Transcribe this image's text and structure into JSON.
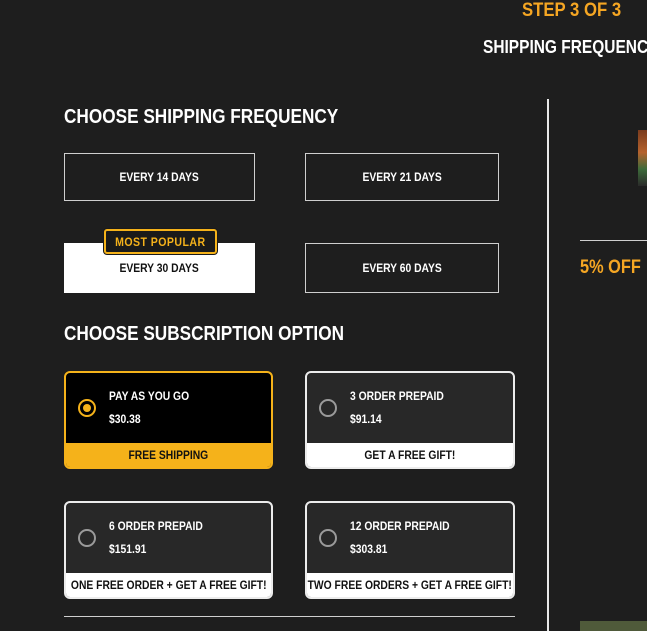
{
  "header": {
    "step": "STEP 3 OF 3",
    "title": "SHIPPING FREQUENCY"
  },
  "frequency": {
    "heading": "CHOOSE SHIPPING FREQUENCY",
    "options": [
      {
        "label": "EVERY 14 DAYS",
        "selected": false
      },
      {
        "label": "EVERY 21 DAYS",
        "selected": false
      },
      {
        "label": "EVERY 30 DAYS",
        "selected": true
      },
      {
        "label": "EVERY 60 DAYS",
        "selected": false
      }
    ],
    "badge": "MOST POPULAR"
  },
  "subscription": {
    "heading": "CHOOSE SUBSCRIPTION OPTION",
    "options": [
      {
        "name": "PAY AS YOU GO",
        "price": "$30.38",
        "perk": "FREE SHIPPING",
        "selected": true
      },
      {
        "name": "3 ORDER PREPAID",
        "price": "$91.14",
        "perk": "GET A FREE GIFT!",
        "selected": false
      },
      {
        "name": "6 ORDER PREPAID",
        "price": "$151.91",
        "perk": "ONE FREE ORDER + GET A FREE GIFT!",
        "selected": false
      },
      {
        "name": "12 ORDER PREPAID",
        "price": "$303.81",
        "perk": "TWO FREE ORDERS + GET A FREE GIFT!",
        "selected": false
      }
    ]
  },
  "sidebar": {
    "discount": "5% OFF"
  },
  "colors": {
    "accent": "#f5b21a",
    "background": "#1e1e1e",
    "card": "#282828"
  },
  "icons": [
    "radio-selected-icon",
    "radio-unselected-icon"
  ]
}
